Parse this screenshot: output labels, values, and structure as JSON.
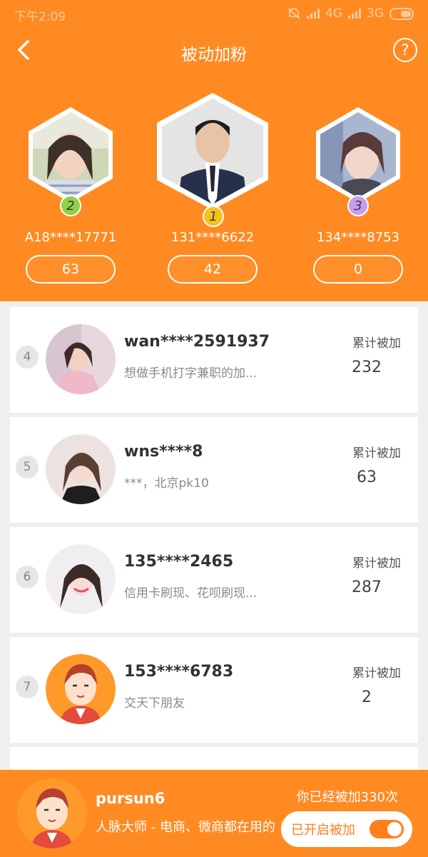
{
  "status": {
    "time": "下午2:09",
    "net1": "4G",
    "net2": "3G"
  },
  "nav": {
    "title": "被动加粉",
    "help": "?"
  },
  "podium": [
    {
      "rank": "2",
      "name": "A18****17771",
      "count": "63",
      "badge_color": "#8fd24a"
    },
    {
      "rank": "1",
      "name": "131****6622",
      "count": "42",
      "badge_color": "#f7c21c"
    },
    {
      "rank": "3",
      "name": "134****8753",
      "count": "0",
      "badge_color": "#c79cf0"
    }
  ],
  "list": [
    {
      "rank": "4",
      "name": "wan****2591937",
      "desc": "想做手机打字兼职的加...",
      "total_label": "累计被加",
      "total": "232"
    },
    {
      "rank": "5",
      "name": "wns****8",
      "desc": "***，北京pk10",
      "total_label": "累计被加",
      "total": "63"
    },
    {
      "rank": "6",
      "name": "135****2465",
      "desc": "信用卡刷现、花呗刷现...",
      "total_label": "累计被加",
      "total": "287"
    },
    {
      "rank": "7",
      "name": "153****6783",
      "desc": "交天下朋友",
      "total_label": "累计被加",
      "total": "2"
    }
  ],
  "footer": {
    "name": "pursun6",
    "desc": "人脉大师 - 电商、微商都在用的",
    "count_text": "你已经被加330次",
    "toggle_label": "已开启被加"
  },
  "colors": {
    "accent": "#ff8a22",
    "toggle": "#ff7f1a"
  }
}
